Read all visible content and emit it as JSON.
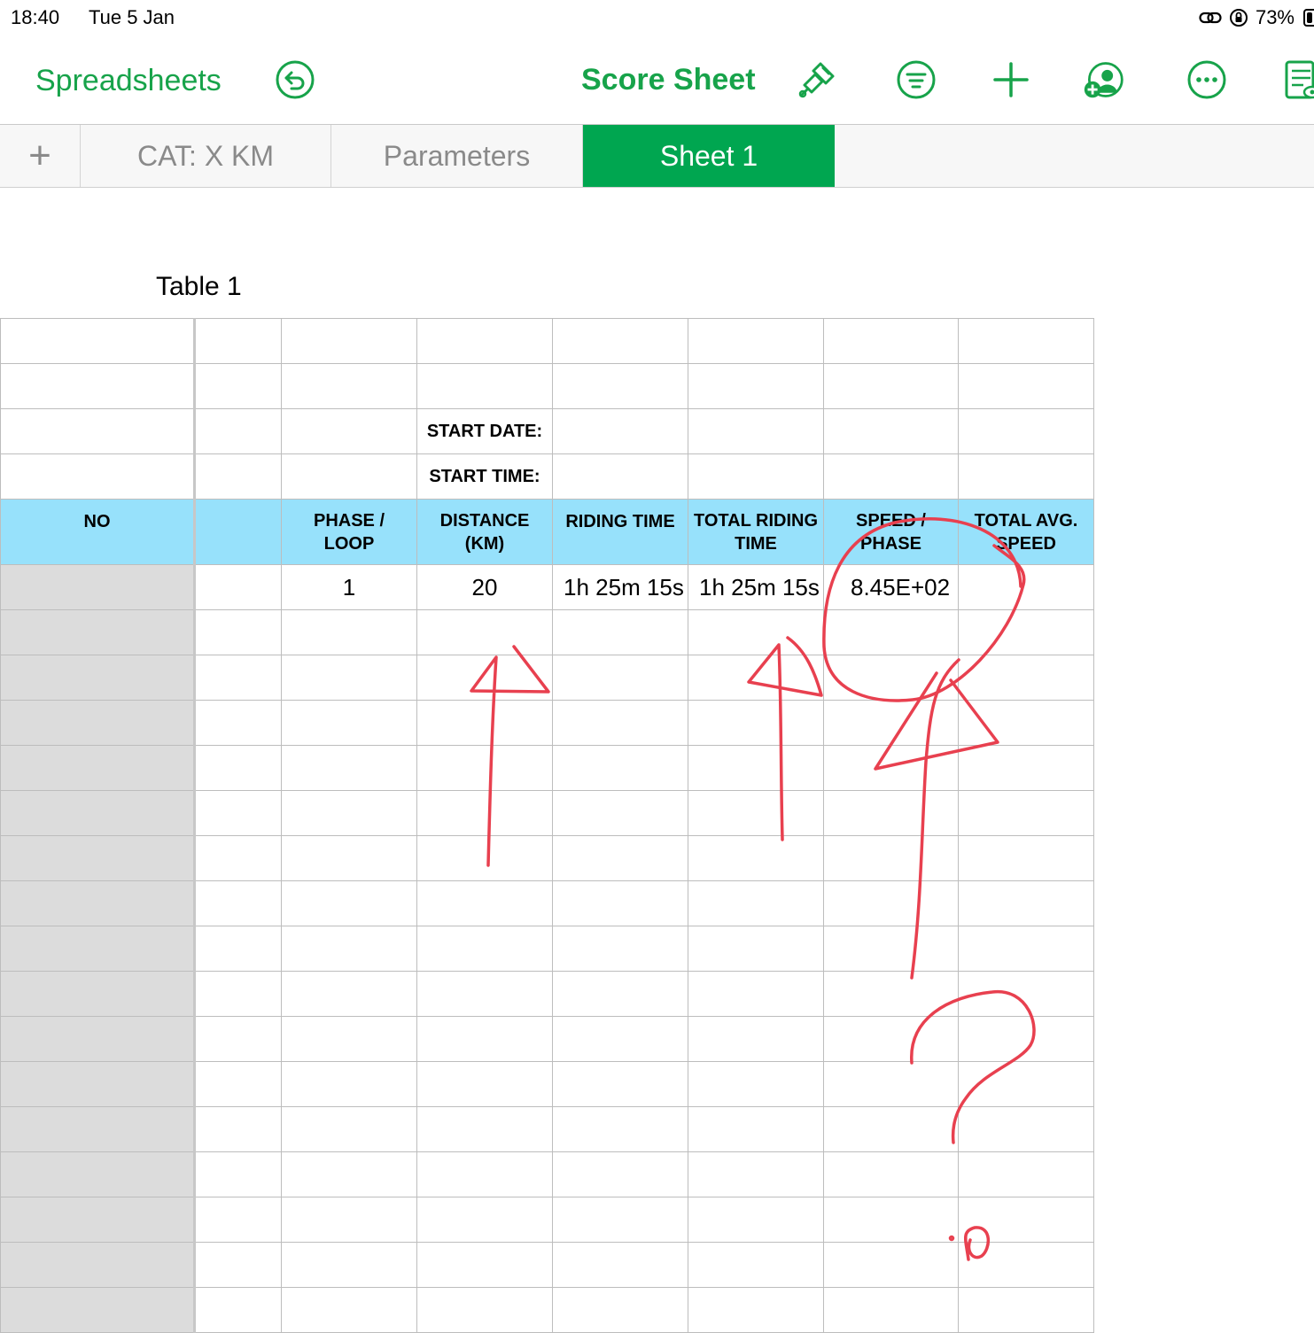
{
  "status_bar": {
    "time": "18:40",
    "date": "Tue 5 Jan",
    "battery": "73%"
  },
  "toolbar": {
    "back_label": "Spreadsheets",
    "document_title": "Score Sheet",
    "icons": [
      "undo-icon",
      "paintbrush-icon",
      "organize-icon",
      "add-icon",
      "collaborate-icon",
      "more-icon",
      "document-view-icon"
    ]
  },
  "tabs": {
    "add_label": "+",
    "items": [
      {
        "label": "CAT: X KM",
        "active": false
      },
      {
        "label": "Parameters",
        "active": false
      },
      {
        "label": "Sheet 1",
        "active": true
      }
    ]
  },
  "table": {
    "title": "Table 1",
    "start_date_label": "START DATE:",
    "start_time_label": "START TIME:",
    "header": {
      "no": "NO",
      "phase_loop": "PHASE / LOOP",
      "distance": "DISTANCE (KM)",
      "riding_time": "RIDING TIME",
      "total_riding_time": "TOTAL RIDING TIME",
      "speed_phase": "SPEED / PHASE",
      "total_avg_speed": "TOTAL AVG. SPEED"
    },
    "rows": [
      {
        "phase_loop": "1",
        "distance": "20",
        "riding_time": "1h 25m 15s",
        "total_riding_time": "1h 25m 15s",
        "speed_phase": "8.45E+02",
        "total_avg_speed": ""
      }
    ]
  },
  "colors": {
    "accent": "#17a34a",
    "active_tab": "#00a650",
    "header_fill": "#97e1fb",
    "frozen_fill": "#dcdcdc",
    "ink": "#e8404f"
  }
}
